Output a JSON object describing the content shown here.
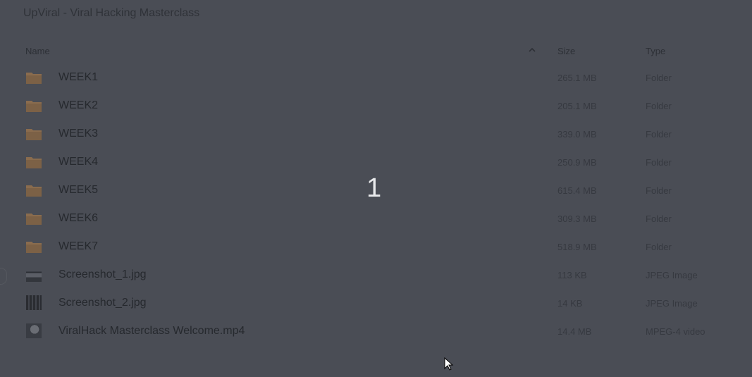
{
  "window": {
    "title": "UpViral - Viral Hacking Masterclass"
  },
  "columns": {
    "name": "Name",
    "size": "Size",
    "type": "Type"
  },
  "files": [
    {
      "name": "WEEK1",
      "size": "265.1 MB",
      "type": "Folder",
      "icon": "folder-icon"
    },
    {
      "name": "WEEK2",
      "size": "205.1 MB",
      "type": "Folder",
      "icon": "folder-icon"
    },
    {
      "name": "WEEK3",
      "size": "339.0 MB",
      "type": "Folder",
      "icon": "folder-icon"
    },
    {
      "name": "WEEK4",
      "size": "250.9 MB",
      "type": "Folder",
      "icon": "folder-icon"
    },
    {
      "name": "WEEK5",
      "size": "615.4 MB",
      "type": "Folder",
      "icon": "folder-icon"
    },
    {
      "name": "WEEK6",
      "size": "309.3 MB",
      "type": "Folder",
      "icon": "folder-icon"
    },
    {
      "name": "WEEK7",
      "size": "518.9 MB",
      "type": "Folder",
      "icon": "folder-icon"
    },
    {
      "name": "Screenshot_1.jpg",
      "size": "113 KB",
      "type": "JPEG Image",
      "icon": "image-thumbnail"
    },
    {
      "name": "Screenshot_2.jpg",
      "size": "14 KB",
      "type": "JPEG Image",
      "icon": "image-thumbnail"
    },
    {
      "name": "ViralHack Masterclass Welcome.mp4",
      "size": "14.4 MB",
      "type": "MPEG-4 video",
      "icon": "video-thumbnail"
    }
  ],
  "overlay": {
    "number": "1"
  },
  "colors": {
    "background": "#4a4d55",
    "folder": "#8a6c4e",
    "overlay_text": "#e9eaec"
  }
}
